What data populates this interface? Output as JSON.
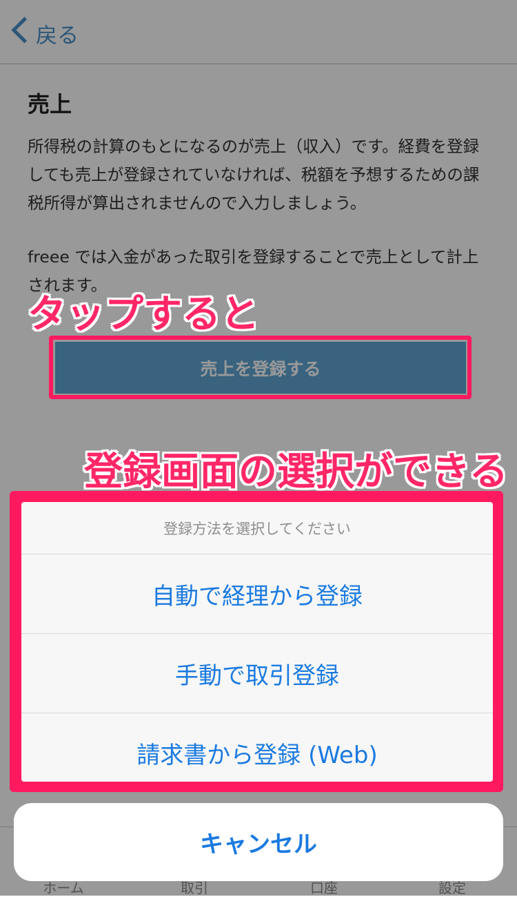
{
  "nav": {
    "back_label": "戻る"
  },
  "content": {
    "title": "売上",
    "paragraph1": "所得税の計算のもとになるのが売上（収入）です。経費を登録しても売上が登録されていなければ、税額を予想するための課税所得が算出されませんので入力しましょう。",
    "paragraph2": "freee では入金があった取引を登録することで売上として計上されます。",
    "register_button": "売上を登録する"
  },
  "annotations": {
    "tap_note": "タップすると",
    "select_note": "登録画面の選択ができる"
  },
  "action_sheet": {
    "title": "登録方法を選択してください",
    "items": [
      {
        "label": "自動で経理から登録"
      },
      {
        "label": "手動で取引登録"
      },
      {
        "label": "請求書から登録 (Web)"
      }
    ],
    "cancel_label": "キャンセル"
  },
  "tabbar": {
    "items": [
      {
        "label": "ホーム"
      },
      {
        "label": "取引"
      },
      {
        "label": "口座"
      },
      {
        "label": "設定"
      }
    ]
  },
  "colors": {
    "accent": "#1a7ae0",
    "annotation": "#ff2767",
    "button": "#5fa6d4"
  }
}
